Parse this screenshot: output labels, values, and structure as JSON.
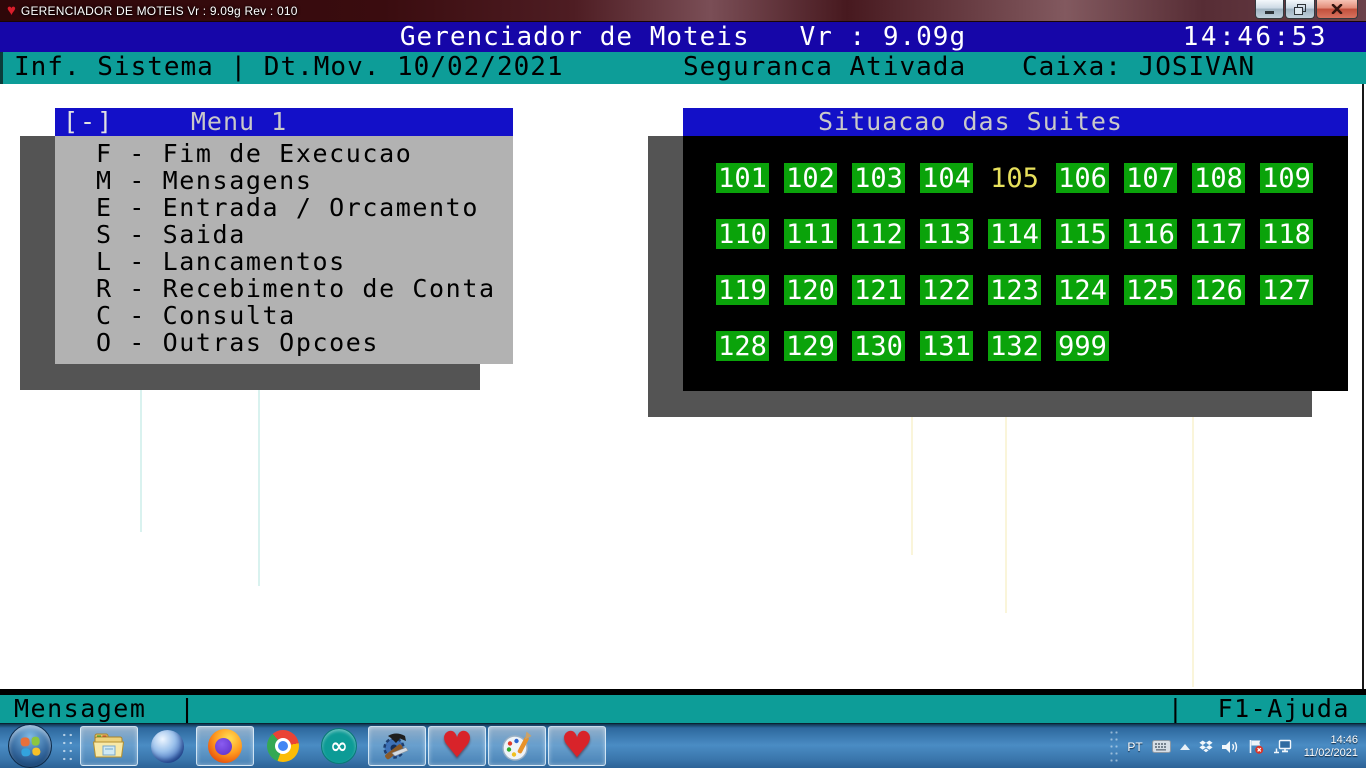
{
  "window": {
    "title": "GERENCIADOR DE MOTEIS  Vr : 9.09g  Rev : 010",
    "controls": {
      "minimize": "minimize",
      "restore": "restore",
      "close": "close"
    }
  },
  "header": {
    "app_title": "Gerenciador de Moteis   Vr : 9.09g",
    "clock": "14:46:53",
    "info": "Inf. Sistema | Dt.Mov. 10/02/2021",
    "security": "Seguranca Ativada",
    "cashier": "Caixa: JOSIVAN"
  },
  "menu": {
    "collapse_label": "[-]",
    "title": "Menu 1",
    "items": [
      {
        "key": "F",
        "label": "Fim de Execucao"
      },
      {
        "key": "M",
        "label": "Mensagens"
      },
      {
        "key": "E",
        "label": "Entrada / Orcamento"
      },
      {
        "key": "S",
        "label": "Saida"
      },
      {
        "key": "L",
        "label": "Lancamentos"
      },
      {
        "key": "R",
        "label": "Recebimento de Conta"
      },
      {
        "key": "C",
        "label": "Consulta"
      },
      {
        "key": "O",
        "label": "Outras Opcoes"
      }
    ]
  },
  "suites": {
    "title": "Situacao das Suites",
    "colors": {
      "available_bg": "#0aa30a",
      "available_text": "#ffffff",
      "selected_bg": "#000000",
      "selected_text": "#e8e15c"
    },
    "rows": [
      [
        {
          "num": "101",
          "state": "available"
        },
        {
          "num": "102",
          "state": "available"
        },
        {
          "num": "103",
          "state": "available"
        },
        {
          "num": "104",
          "state": "available"
        },
        {
          "num": "105",
          "state": "selected"
        },
        {
          "num": "106",
          "state": "available"
        },
        {
          "num": "107",
          "state": "available"
        },
        {
          "num": "108",
          "state": "available"
        },
        {
          "num": "109",
          "state": "available"
        }
      ],
      [
        {
          "num": "110",
          "state": "available"
        },
        {
          "num": "111",
          "state": "available"
        },
        {
          "num": "112",
          "state": "available"
        },
        {
          "num": "113",
          "state": "available"
        },
        {
          "num": "114",
          "state": "available"
        },
        {
          "num": "115",
          "state": "available"
        },
        {
          "num": "116",
          "state": "available"
        },
        {
          "num": "117",
          "state": "available"
        },
        {
          "num": "118",
          "state": "available"
        }
      ],
      [
        {
          "num": "119",
          "state": "available"
        },
        {
          "num": "120",
          "state": "available"
        },
        {
          "num": "121",
          "state": "available"
        },
        {
          "num": "122",
          "state": "available"
        },
        {
          "num": "123",
          "state": "available"
        },
        {
          "num": "124",
          "state": "available"
        },
        {
          "num": "125",
          "state": "available"
        },
        {
          "num": "126",
          "state": "available"
        },
        {
          "num": "127",
          "state": "available"
        }
      ],
      [
        {
          "num": "128",
          "state": "available"
        },
        {
          "num": "129",
          "state": "available"
        },
        {
          "num": "130",
          "state": "available"
        },
        {
          "num": "131",
          "state": "available"
        },
        {
          "num": "132",
          "state": "available"
        },
        {
          "num": "999",
          "state": "available"
        }
      ]
    ]
  },
  "statusbar": {
    "left": "Mensagem  |",
    "right": "|  F1-Ajuda"
  },
  "taskbar": {
    "apps": [
      {
        "name": "windows-explorer",
        "icon": "folder",
        "running": true
      },
      {
        "name": "winbox",
        "icon": "blue-sphere",
        "running": false
      },
      {
        "name": "firefox",
        "icon": "firefox",
        "running": true
      },
      {
        "name": "chrome",
        "icon": "chrome",
        "running": false
      },
      {
        "name": "arduino",
        "icon": "arduino",
        "running": false
      },
      {
        "name": "dev-tools",
        "icon": "tools",
        "running": true
      },
      {
        "name": "motel-app",
        "icon": "heart",
        "running": true
      },
      {
        "name": "paint",
        "icon": "palette",
        "running": true
      },
      {
        "name": "motel-app-2",
        "icon": "heart",
        "running": true
      }
    ],
    "tray": {
      "language": "PT",
      "clock_time": "14:46",
      "clock_date": "11/02/2021"
    }
  }
}
